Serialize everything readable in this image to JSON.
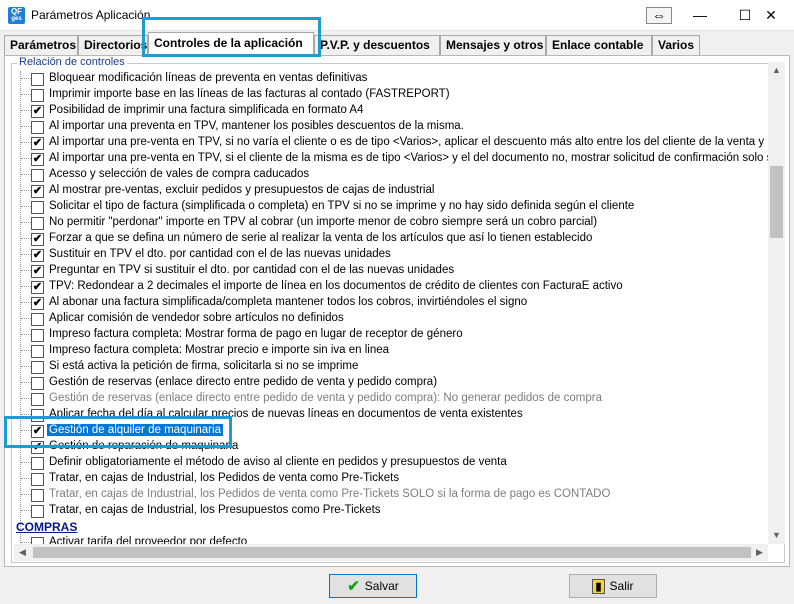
{
  "window": {
    "title": "Parámetros Aplicación",
    "app_icon_line1": "QF",
    "app_icon_line2": "ges",
    "restore_icon": "⇔",
    "minimize_icon": "—",
    "maximize_icon": "☐",
    "close_icon": "✕"
  },
  "tabs": [
    {
      "label": "Parámetros",
      "active": false
    },
    {
      "label": "Directorios",
      "active": false
    },
    {
      "label": "Controles de la aplicación",
      "active": true
    },
    {
      "label": "P.V.P. y descuentos",
      "active": false
    },
    {
      "label": "Mensajes y otros",
      "active": false
    },
    {
      "label": "Enlace contable",
      "active": false
    },
    {
      "label": "Varios",
      "active": false
    }
  ],
  "group_label": "Relación de controles",
  "items": [
    {
      "label": "Bloquear modificación líneas de preventa en ventas definitivas",
      "checked": false
    },
    {
      "label": "Imprimir importe base en las líneas de las facturas al contado (FASTREPORT)",
      "checked": false
    },
    {
      "label": "Posibilidad de imprimir una factura simplificada en formato A4",
      "checked": true
    },
    {
      "label": "Al importar una preventa en TPV, mantener los posibles descuentos de la misma.",
      "checked": false
    },
    {
      "label": "Al importar una pre-venta en TPV, si no varía el cliente o es de tipo <Varios>, aplicar el descuento más alto entre los del cliente de la venta y los de la p",
      "checked": true
    },
    {
      "label": "Al importar una pre-venta en TPV, si el cliente de la misma es de tipo <Varios> y el del documento no, mostrar solicitud de confirmación solo si varían pr",
      "checked": true
    },
    {
      "label": "Acesso y selección de vales de compra caducados",
      "checked": false
    },
    {
      "label": "Al mostrar pre-ventas, excluir pedidos y presupuestos de cajas de industrial",
      "checked": true
    },
    {
      "label": "Solicitar el tipo de factura (simplificada o completa) en TPV si no se imprime y no hay sido definida según el cliente",
      "checked": false
    },
    {
      "label": "No permitir \"perdonar\" importe en TPV al cobrar (un importe menor de cobro siempre será un cobro parcial)",
      "checked": false
    },
    {
      "label": "Forzar a que se defina un número de serie al realizar la venta de los artículos que así lo tienen establecido",
      "checked": true
    },
    {
      "label": "Sustituir en TPV el dto. por cantidad con el de las nuevas unidades",
      "checked": true
    },
    {
      "label": "Preguntar en TPV si sustituir el dto. por cantidad con el de las nuevas unidades",
      "checked": true
    },
    {
      "label": "TPV: Redondear a 2 decimales el importe de línea en los documentos de crédito de clientes con FacturaE activo",
      "checked": true
    },
    {
      "label": "Al abonar una factura simplificada/completa mantener todos los cobros, invirtiéndoles el signo",
      "checked": true
    },
    {
      "label": "Aplicar comisión de vendedor sobre artículos no definidos",
      "checked": false
    },
    {
      "label": "Impreso factura completa: Mostrar forma de pago en lugar de receptor de género",
      "checked": false
    },
    {
      "label": "Impreso factura completa: Mostrar precio e importe sin iva en linea",
      "checked": false
    },
    {
      "label": "Si está activa la petición de firma, solicitarla si no se imprime",
      "checked": false
    },
    {
      "label": "Gestión de reservas (enlace directo entre pedido de venta y pedido compra)",
      "checked": false
    },
    {
      "label": "Gestión de reservas (enlace directo entre pedido de venta y pedido compra): No generar pedidos de compra",
      "checked": false,
      "dim": true
    },
    {
      "label": "Aplicar fecha del día al calcular precios de nuevas líneas en documentos de venta existentes",
      "checked": false
    },
    {
      "label": "Gestión de alquiler de maquinaria",
      "checked": true,
      "selected": true
    },
    {
      "label": "Gestión de reparación de maquinaria",
      "checked": true
    },
    {
      "label": "Definir obligatoriamente el método de aviso al cliente en pedidos y presupuestos de venta",
      "checked": false
    },
    {
      "label": "Tratar, en cajas de Industrial, los Pedidos de venta como Pre-Tickets",
      "checked": false
    },
    {
      "label": "Tratar, en cajas de Industrial, los Pedidos de venta como Pre-Tickets SOLO si la forma de pago es CONTADO",
      "checked": false,
      "dim": true
    },
    {
      "label": "Tratar, en cajas de Industrial, los Presupuestos como Pre-Tickets",
      "checked": false
    }
  ],
  "section": "COMPRAS",
  "partial_item": {
    "label": "Activar tarifa del proveedor por defecto",
    "checked": false
  },
  "check_glyph": "✔",
  "buttons": {
    "save_label": "Salvar",
    "save_icon": "✔",
    "exit_label": "Salir",
    "exit_icon": "▮"
  },
  "colors": {
    "highlight": "#1c9bd8",
    "selection": "#0078d7",
    "section": "#001a8c"
  }
}
